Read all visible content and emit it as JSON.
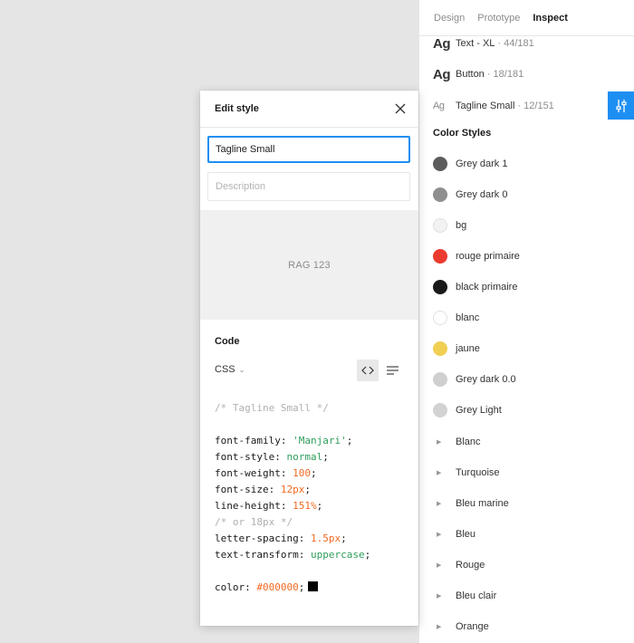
{
  "tabs": [
    {
      "label": "Design",
      "active": false
    },
    {
      "label": "Prototype",
      "active": false
    },
    {
      "label": "Inspect",
      "active": true
    }
  ],
  "text_styles": [
    {
      "icon": "Ag",
      "name": "Text - XL",
      "count": "44/181"
    },
    {
      "icon": "Ag",
      "name": "Button",
      "count": "18/181"
    },
    {
      "icon": "Ag",
      "name": "Tagline Small",
      "count": "12/151"
    }
  ],
  "color_styles_title": "Color Styles",
  "color_styles": [
    {
      "name": "Grey dark 1",
      "color": "#5c5c5c"
    },
    {
      "name": "Grey dark 0",
      "color": "#8f8f8f"
    },
    {
      "name": "bg",
      "color": "#f2f2f2"
    },
    {
      "name": "rouge primaire",
      "color": "#ea3b2e"
    },
    {
      "name": "black primaire",
      "color": "#1a1a1a"
    },
    {
      "name": "blanc",
      "color": "#ffffff"
    },
    {
      "name": "jaune",
      "color": "#f1cf53"
    },
    {
      "name": "Grey dark 0.0",
      "color": "#cfcfcf"
    },
    {
      "name": "Grey Light",
      "color": "#d2d2d2"
    }
  ],
  "color_groups": [
    "Blanc",
    "Turquoise",
    "Bleu marine",
    "Bleu",
    "Rouge",
    "Bleu clair",
    "Orange"
  ],
  "modal": {
    "title": "Edit style",
    "name_value": "Tagline Small",
    "description_placeholder": "Description",
    "preview_text": "RAG 123",
    "code_title": "Code",
    "language": "CSS",
    "code": {
      "comment_line": "/* Tagline Small */",
      "font_family": {
        "prop": "font-family",
        "value": "'Manjari'"
      },
      "font_style": {
        "prop": "font-style",
        "value": "normal"
      },
      "font_weight": {
        "prop": "font-weight",
        "value": "100"
      },
      "font_size": {
        "prop": "font-size",
        "value": "12px"
      },
      "line_height": {
        "prop": "line-height",
        "value": "151%"
      },
      "line_height_comment": "/* or 18px */",
      "letter_spacing": {
        "prop": "letter-spacing",
        "value": "1.5px"
      },
      "text_transform": {
        "prop": "text-transform",
        "value": "uppercase"
      },
      "color": {
        "prop": "color",
        "value": "#000000"
      }
    }
  },
  "accent_color": "#1e8ff2"
}
